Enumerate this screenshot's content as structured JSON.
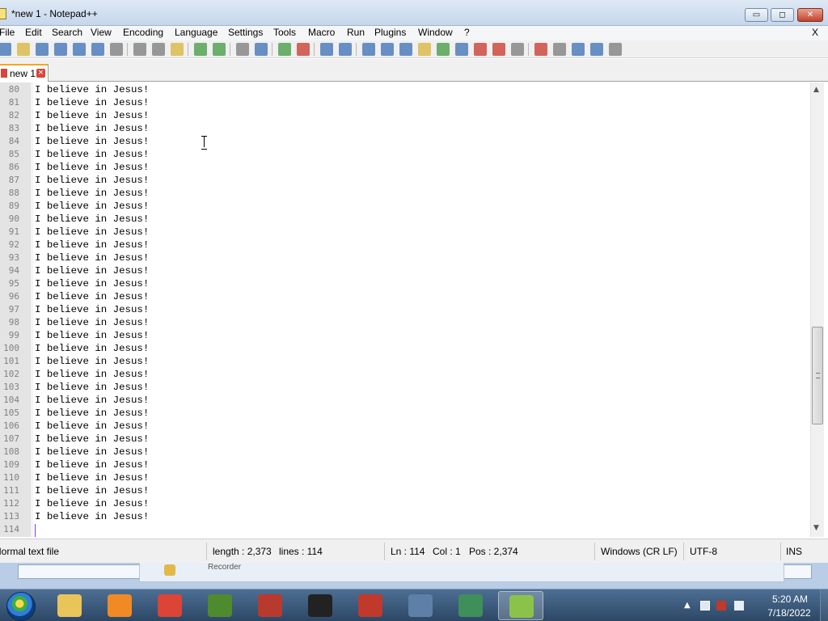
{
  "window": {
    "title": "*new 1 - Notepad++",
    "min_glyph": "▭",
    "max_glyph": "◻",
    "close_glyph": "✕"
  },
  "menu": {
    "items": [
      "File",
      "Edit",
      "Search",
      "View",
      "Encoding",
      "Language",
      "Settings",
      "Tools",
      "Macro",
      "Run",
      "Plugins",
      "Window",
      "?"
    ],
    "close_x": "X"
  },
  "toolbar": {
    "icons": [
      "new-file-icon",
      "open-file-icon",
      "save-icon",
      "save-all-icon",
      "close-icon",
      "close-all-icon",
      "print-icon",
      "cut-icon",
      "copy-icon",
      "paste-icon",
      "undo-icon",
      "redo-icon",
      "find-icon",
      "replace-icon",
      "zoom-in-icon",
      "zoom-out-icon",
      "sync-vertical-icon",
      "sync-horizontal-icon",
      "word-wrap-icon",
      "show-all-chars-icon",
      "indent-guide-icon",
      "user-language-icon",
      "doc-map-icon",
      "function-list-icon",
      "folder-workspace-icon",
      "folder-icon",
      "monitor-icon",
      "record-macro-icon",
      "stop-record-icon",
      "playback-icon",
      "run-macro-multiple-icon",
      "save-macro-icon"
    ],
    "colors": {
      "blue": "#3b6fb6",
      "green": "#3f9a3f",
      "red": "#c8352b",
      "gray": "#7a7a7a",
      "yellow": "#d9b43a"
    }
  },
  "tab": {
    "label": "new 1",
    "close_glyph": "×"
  },
  "editor": {
    "lines": [
      {
        "n": "80",
        "text": "I believe in Jesus!"
      },
      {
        "n": "81",
        "text": "I believe in Jesus!"
      },
      {
        "n": "82",
        "text": "I believe in Jesus!"
      },
      {
        "n": "83",
        "text": "I believe in Jesus!"
      },
      {
        "n": "84",
        "text": "I believe in Jesus!"
      },
      {
        "n": "85",
        "text": "I believe in Jesus!"
      },
      {
        "n": "86",
        "text": "I believe in Jesus!"
      },
      {
        "n": "87",
        "text": "I believe in Jesus!"
      },
      {
        "n": "88",
        "text": "I believe in Jesus!"
      },
      {
        "n": "89",
        "text": "I believe in Jesus!"
      },
      {
        "n": "90",
        "text": "I believe in Jesus!"
      },
      {
        "n": "91",
        "text": "I believe in Jesus!"
      },
      {
        "n": "92",
        "text": "I believe in Jesus!"
      },
      {
        "n": "93",
        "text": "I believe in Jesus!"
      },
      {
        "n": "94",
        "text": "I believe in Jesus!"
      },
      {
        "n": "95",
        "text": "I believe in Jesus!"
      },
      {
        "n": "96",
        "text": "I believe in Jesus!"
      },
      {
        "n": "97",
        "text": "I believe in Jesus!"
      },
      {
        "n": "98",
        "text": "I believe in Jesus!"
      },
      {
        "n": "99",
        "text": "I believe in Jesus!"
      },
      {
        "n": "100",
        "text": "I believe in Jesus!"
      },
      {
        "n": "101",
        "text": "I believe in Jesus!"
      },
      {
        "n": "102",
        "text": "I believe in Jesus!"
      },
      {
        "n": "103",
        "text": "I believe in Jesus!"
      },
      {
        "n": "104",
        "text": "I believe in Jesus!"
      },
      {
        "n": "105",
        "text": "I believe in Jesus!"
      },
      {
        "n": "106",
        "text": "I believe in Jesus!"
      },
      {
        "n": "107",
        "text": "I believe in Jesus!"
      },
      {
        "n": "108",
        "text": "I believe in Jesus!"
      },
      {
        "n": "109",
        "text": "I believe in Jesus!"
      },
      {
        "n": "110",
        "text": "I believe in Jesus!"
      },
      {
        "n": "111",
        "text": "I believe in Jesus!"
      },
      {
        "n": "112",
        "text": "I believe in Jesus!"
      },
      {
        "n": "113",
        "text": "I believe in Jesus!"
      },
      {
        "n": "114",
        "text": ""
      }
    ],
    "caret_color": "#7a3cff"
  },
  "scrollbar": {
    "up_glyph": "▲",
    "down_glyph": "▼"
  },
  "status": {
    "file_type": "Normal text file",
    "length": "length : 2,373",
    "lines": "lines : 114",
    "ln": "Ln : 114",
    "col": "Col : 1",
    "pos": "Pos : 2,374",
    "eol": "Windows (CR LF)",
    "encoding": "UTF-8",
    "mode": "INS"
  },
  "behind_window": {
    "text": "Recorder"
  },
  "taskbar": {
    "tasks": [
      {
        "name": "task-explorer",
        "icon": "folder-icon",
        "color": "#e8c45a"
      },
      {
        "name": "task-media-player",
        "icon": "media-player-icon",
        "color": "#f08a24"
      },
      {
        "name": "task-chrome",
        "icon": "chrome-icon",
        "color": "#db4437"
      },
      {
        "name": "task-tree-app",
        "icon": "tree-icon",
        "color": "#4f8a2e"
      },
      {
        "name": "task-installer",
        "icon": "install-icon",
        "color": "#b83a2e"
      },
      {
        "name": "task-face-app",
        "icon": "face-icon",
        "color": "#222222"
      },
      {
        "name": "task-snoopy-app",
        "icon": "snoopy-icon",
        "color": "#c0392b"
      },
      {
        "name": "task-network-app",
        "icon": "network-computer-icon",
        "color": "#5d7fa8"
      },
      {
        "name": "task-monitor-app",
        "icon": "monitor-icon",
        "color": "#3f8f5a"
      },
      {
        "name": "task-notepadpp",
        "icon": "notepadpp-icon",
        "color": "#8bc34a"
      }
    ],
    "clock_time": "5:20 AM",
    "clock_date": "7/18/2022",
    "tray_chevron": "▲"
  }
}
